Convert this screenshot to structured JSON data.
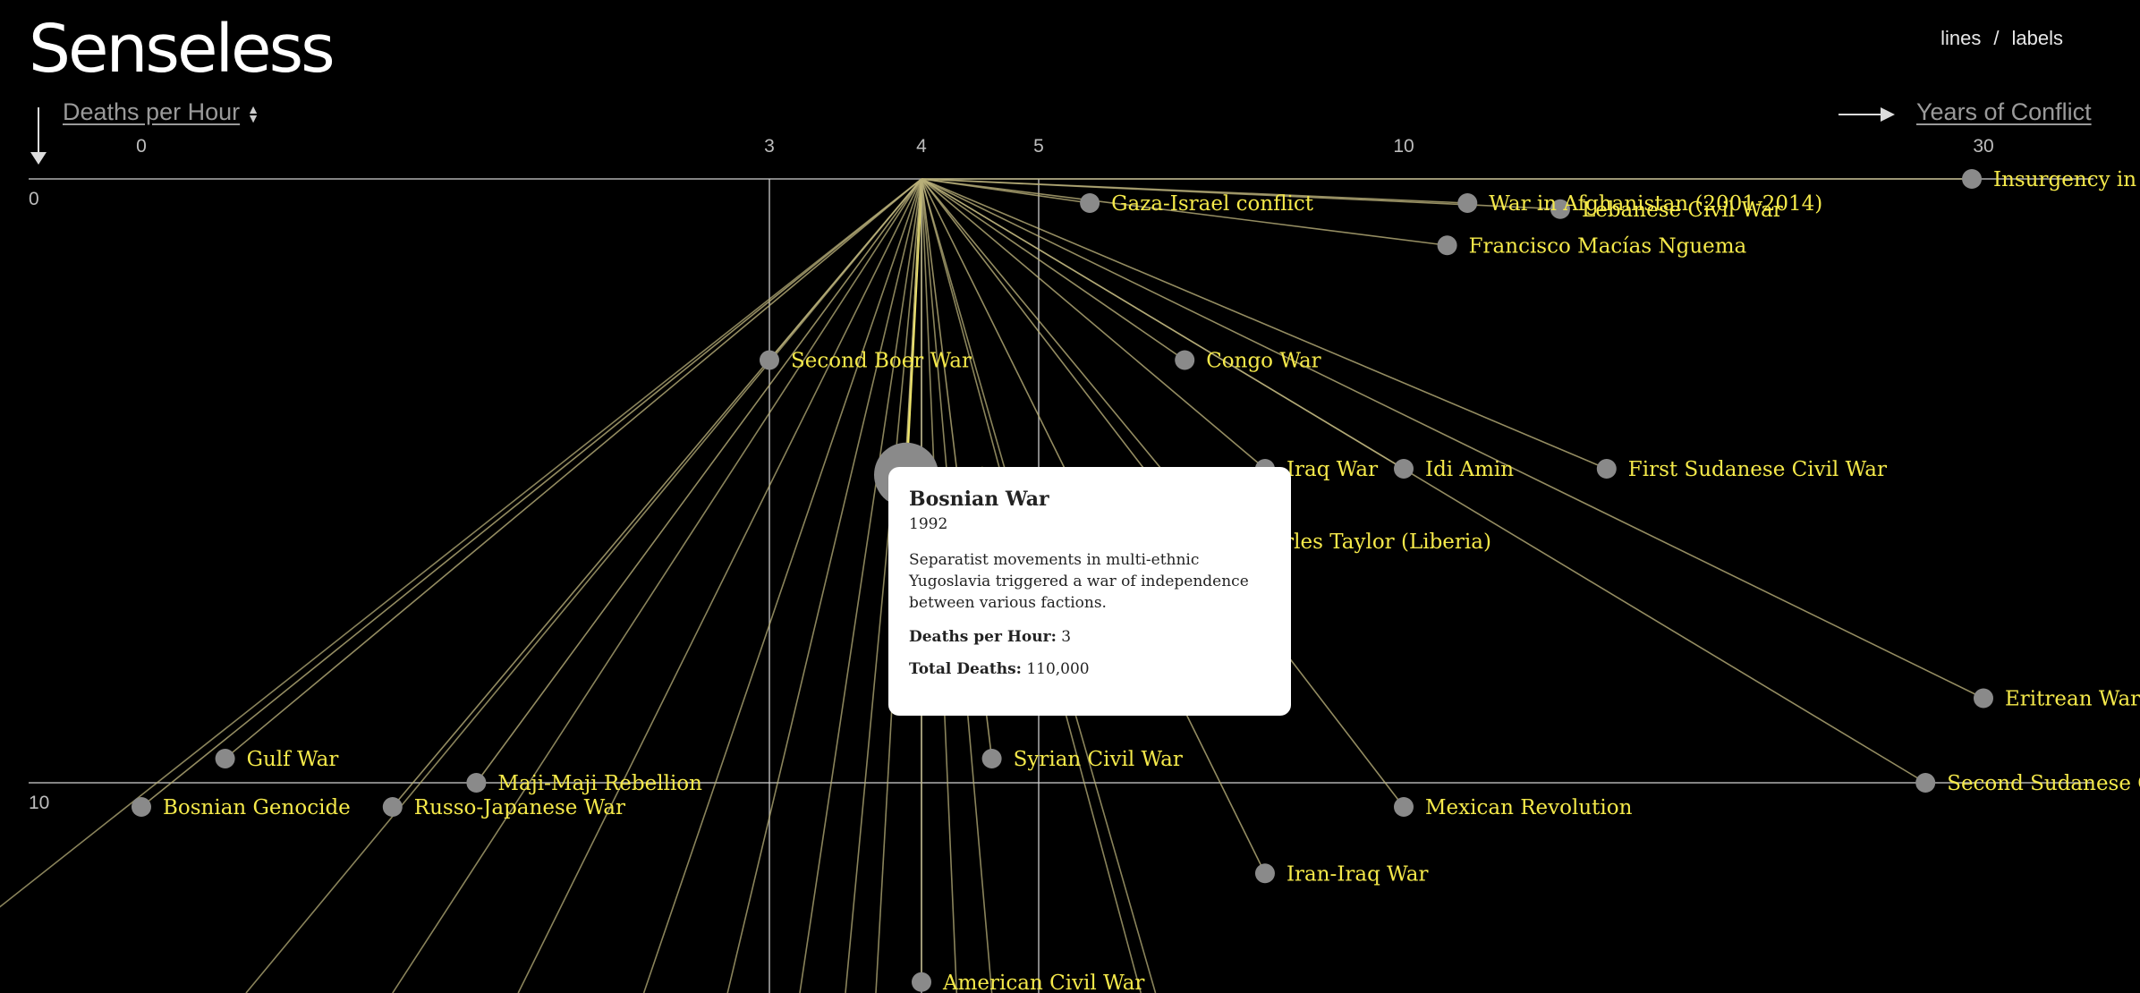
{
  "app": {
    "title": "Senseless",
    "toggle_lines": "lines",
    "toggle_sep": "/",
    "toggle_labels": "labels",
    "y_selector": "Deaths per Hour",
    "x_selector": "Years of Conflict"
  },
  "tooltip": {
    "name": "Bosnian War",
    "year": "1992",
    "description": "Separatist movements in multi-ethnic Yugoslavia triggered a war of independence between various factions.",
    "deaths_per_hour_label": "Deaths per Hour:",
    "deaths_per_hour_value": "3",
    "total_deaths_label": "Total Deaths:",
    "total_deaths_value": "110,000"
  },
  "colors": {
    "background": "#000000",
    "label": "#f5e94a",
    "dot": "#8a8a8a",
    "line": "#b9b07a",
    "highlight_line": "#f2e86a",
    "axis": "#cfcfcf"
  },
  "chart_data": {
    "type": "scatter",
    "xlabel": "Years of Conflict",
    "ylabel": "Deaths per Hour",
    "x_ticks": [
      "0",
      "3",
      "4",
      "5",
      "10",
      "30"
    ],
    "y_ticks": [
      "0",
      "10"
    ],
    "x_guides": [
      3,
      4,
      5
    ],
    "y_guides": [
      0,
      10
    ],
    "hub": {
      "x": 4,
      "y": 0
    },
    "points": [
      {
        "name": "Insurgency in Aceh",
        "x": 29.6,
        "y": 0.0
      },
      {
        "name": "Gaza-Israel conflict",
        "x": 5.7,
        "y": 0.4
      },
      {
        "name": "War in Afghanistan (2001-2014)",
        "x": 12.2,
        "y": 0.4
      },
      {
        "name": "Lebanese Civil War",
        "x": 15.4,
        "y": 0.5
      },
      {
        "name": "Francisco Macías Nguema",
        "x": 11.5,
        "y": 1.1
      },
      {
        "name": "Second Boer War",
        "x": 3.0,
        "y": 3.0
      },
      {
        "name": "Congo War",
        "x": 7.0,
        "y": 3.0
      },
      {
        "name": "Bosnian War",
        "x": 3.9,
        "y": 4.9
      },
      {
        "name": "Iraq War",
        "x": 8.1,
        "y": 4.8
      },
      {
        "name": "Idi Amin",
        "x": 10.0,
        "y": 4.8
      },
      {
        "name": "First Sudanese Civil War",
        "x": 17.0,
        "y": 4.8
      },
      {
        "name": "Charles Taylor (Liberia)",
        "x": 7.5,
        "y": 6.0
      },
      {
        "name": "Eritrean War of Independence",
        "x": 30.0,
        "y": 8.6
      },
      {
        "name": "Gulf War",
        "x": 0.4,
        "y": 9.6
      },
      {
        "name": "Syrian Civil War",
        "x": 4.6,
        "y": 9.6
      },
      {
        "name": "Maji-Maji Rebellion",
        "x": 1.6,
        "y": 10.0
      },
      {
        "name": "Second Sudanese Civil War",
        "x": 28.0,
        "y": 10.0
      },
      {
        "name": "Bosnian Genocide",
        "x": 0.0,
        "y": 10.4
      },
      {
        "name": "Russo-Japanese War",
        "x": 1.2,
        "y": 10.4
      },
      {
        "name": "Mexican Revolution",
        "x": 10.0,
        "y": 10.4
      },
      {
        "name": "Iran-Iraq War",
        "x": 8.1,
        "y": 11.5
      },
      {
        "name": "American Civil War",
        "x": 4.0,
        "y": 13.3
      }
    ]
  }
}
